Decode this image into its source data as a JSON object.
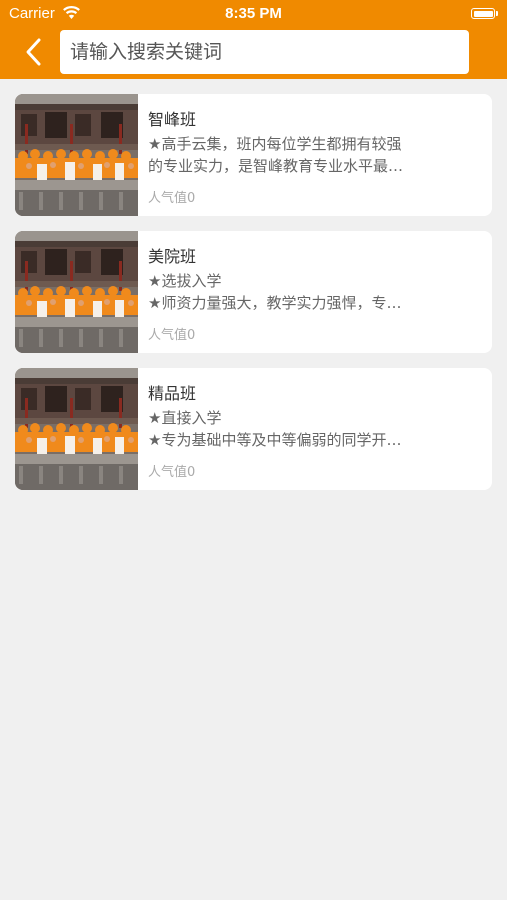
{
  "status": {
    "carrier": "Carrier",
    "time": "8:35 PM"
  },
  "search": {
    "placeholder": "请输入搜索关键词"
  },
  "icons": {
    "back": "chevron-left-icon",
    "wifi": "wifi-icon",
    "battery": "battery-icon"
  },
  "colors": {
    "accent": "#f08a00",
    "background": "#f0f0f0",
    "card": "#ffffff"
  },
  "courses": [
    {
      "title": "智峰班",
      "desc_line1": "★高手云集，班内每位学生都拥有较强",
      "desc_line2": "的专业实力，是智峰教育专业水平最…",
      "popularity": "人气值0"
    },
    {
      "title": "美院班",
      "desc_line1": "★选拔入学",
      "desc_line2": "★师资力量强大，教学实力强悍，专…",
      "popularity": "人气值0"
    },
    {
      "title": "精品班",
      "desc_line1": "★直接入学",
      "desc_line2": "★专为基础中等及中等偏弱的同学开…",
      "popularity": "人气值0"
    }
  ]
}
